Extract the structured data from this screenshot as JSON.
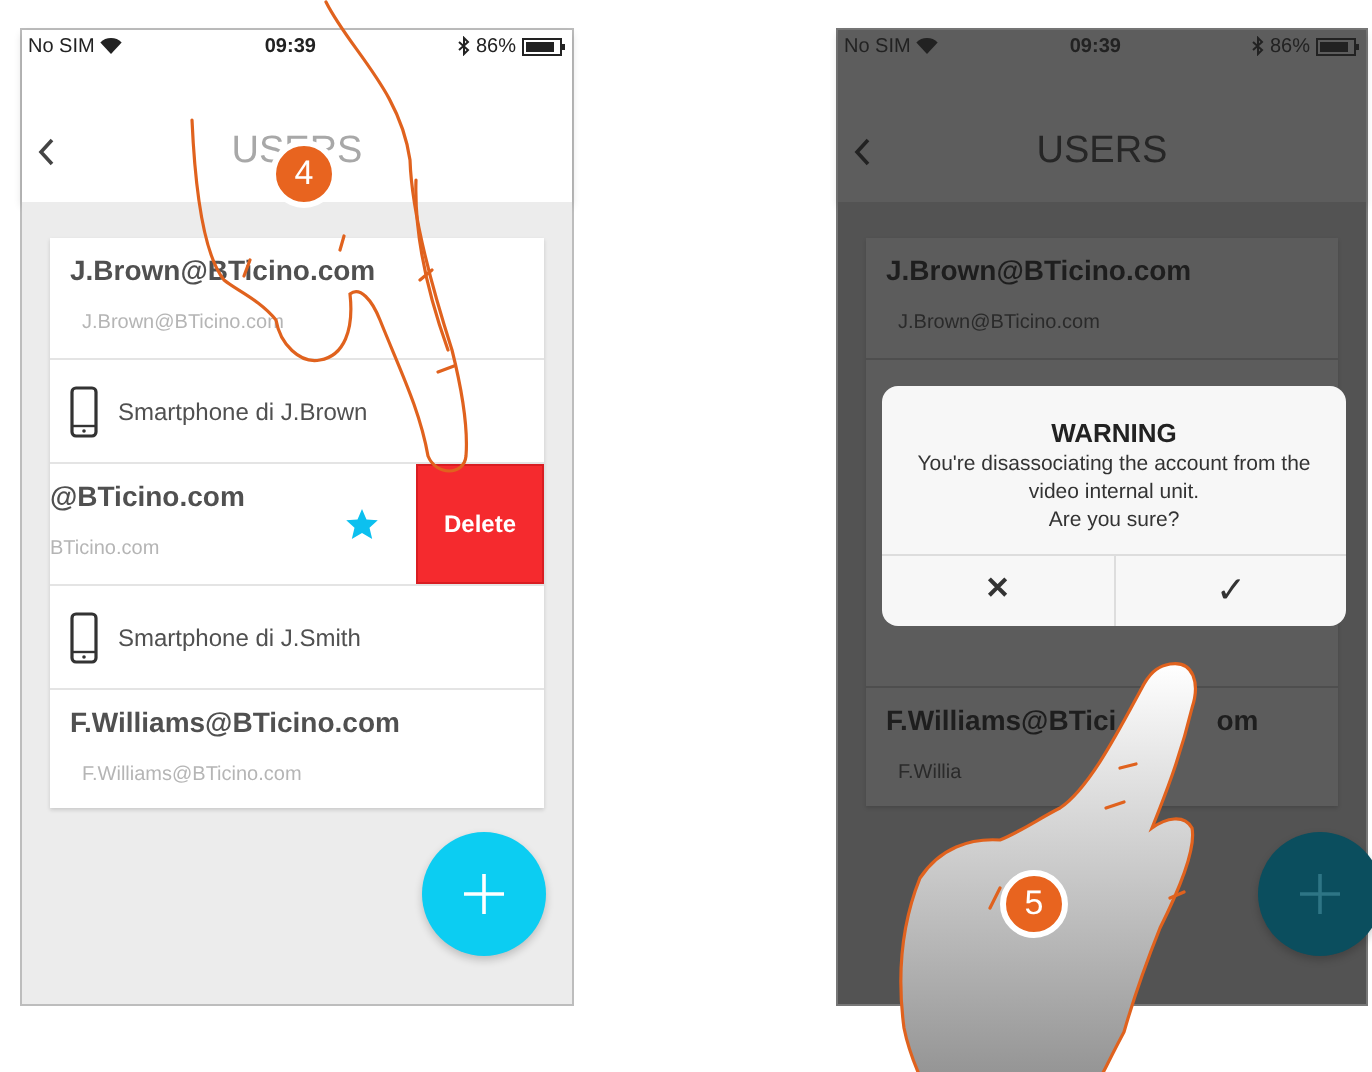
{
  "screens": [
    {
      "dimmed": false,
      "status_bar": {
        "carrier": "No SIM",
        "time": "09:39",
        "battery": "86%"
      },
      "header": {
        "title": "USERS"
      },
      "users": [
        {
          "kind": "account",
          "title": "J.Brown@BTicino.com",
          "subtitle": "J.Brown@BTicino.com"
        },
        {
          "kind": "device",
          "title": "Smartphone di J.Brown"
        },
        {
          "kind": "swiped",
          "title": "@BTicino.com",
          "subtitle": "BTicino.com",
          "favorite": true,
          "action": "Delete"
        },
        {
          "kind": "device",
          "title": "Smartphone di J.Smith"
        },
        {
          "kind": "account",
          "title": "F.Williams@BTicino.com",
          "subtitle": "F.Williams@BTicino.com"
        }
      ],
      "step": "4"
    },
    {
      "dimmed": true,
      "status_bar": {
        "carrier": "No SIM",
        "time": "09:39",
        "battery": "86%"
      },
      "header": {
        "title": "USERS"
      },
      "users": [
        {
          "kind": "account",
          "title": "J.Brown@BTicino.com",
          "subtitle": "J.Brown@BTicino.com"
        },
        {
          "kind": "covered"
        },
        {
          "kind": "partial",
          "title_parts": [
            "F.Williams@BTici",
            "om"
          ],
          "subtitle": "F.Willia"
        }
      ],
      "dialog": {
        "title": "WARNING",
        "message": "You're disassociating the account from the video internal unit.",
        "question": "Are you sure?",
        "cancel": "✕",
        "confirm": "✓"
      },
      "step": "5"
    }
  ]
}
